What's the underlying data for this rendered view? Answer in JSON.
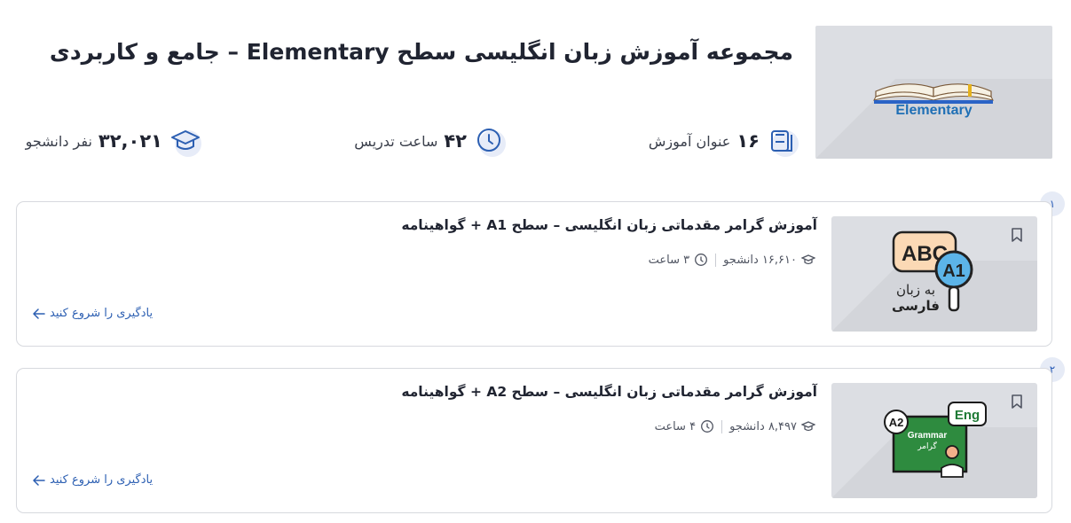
{
  "collection": {
    "title": "مجموعه آموزش زبان انگلیسی سطح Elementary – جامع و کاربردی",
    "thumbnail_text": "Elementary",
    "stats": {
      "titles_value": "۱۶",
      "titles_label": "عنوان آموزش",
      "hours_value": "۴۲",
      "hours_label": "ساعت تدریس",
      "students_value": "۳۲,۰۲۱",
      "students_label": "نفر دانشجو"
    }
  },
  "courses": [
    {
      "index": "۱",
      "title": "آموزش گرامر مقدماتی زبان انگلیسی – سطح A1 + گواهینامه",
      "students": "۱۶,۶۱۰ دانشجو",
      "duration": "۳ ساعت",
      "start_label": "یادگیری را شروع کنید",
      "thumb": {
        "top_text": "ABC",
        "badge": "A1",
        "line1": "به زبان",
        "line2": "فارسی"
      }
    },
    {
      "index": "۲",
      "title": "آموزش گرامر مقدماتی زبان انگلیسی – سطح A2 + گواهینامه",
      "students": "۸,۴۹۷ دانشجو",
      "duration": "۴ ساعت",
      "start_label": "یادگیری را شروع کنید",
      "thumb": {
        "badge": "A2",
        "bubble": "Eng",
        "board_line1": "Grammar",
        "board_line2": "گرامر"
      }
    }
  ],
  "icons": {
    "titles": "book-stack-icon",
    "hours": "clock-icon",
    "students": "graduation-cap-icon",
    "bookmark": "bookmark-icon",
    "arrow": "arrow-left-icon"
  },
  "colors": {
    "accent": "#2c5fb2",
    "thumbnail_bg": "#dcdee3",
    "card_border": "#d7d9de",
    "icon_circle": "#e7ecf8"
  }
}
